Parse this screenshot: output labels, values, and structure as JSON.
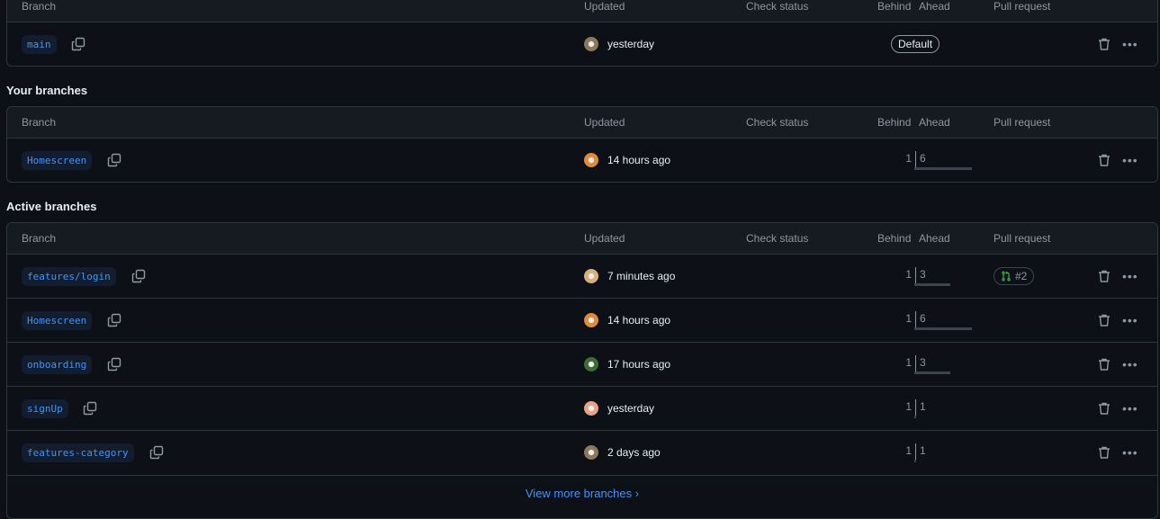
{
  "columns": {
    "branch": "Branch",
    "updated": "Updated",
    "check": "Check status",
    "behind": "Behind",
    "ahead": "Ahead",
    "pr": "Pull request"
  },
  "default_section": {
    "rows": [
      {
        "name": "main",
        "updated": "yesterday",
        "avatar": "#8a7a5a",
        "badge": "Default"
      }
    ]
  },
  "your_branches": {
    "title": "Your branches",
    "rows": [
      {
        "name": "Homescreen",
        "updated": "14 hours ago",
        "avatar": "#e08a3a",
        "behind": 1,
        "ahead": 6
      }
    ]
  },
  "active_branches": {
    "title": "Active branches",
    "rows": [
      {
        "name": "features/login",
        "updated": "7 minutes ago",
        "avatar": "#d9b07a",
        "behind": 1,
        "ahead": 3,
        "pr": "#2"
      },
      {
        "name": "Homescreen",
        "updated": "14 hours ago",
        "avatar": "#e08a3a",
        "behind": 1,
        "ahead": 6
      },
      {
        "name": "onboarding",
        "updated": "17 hours ago",
        "avatar": "#3f6b35",
        "behind": 1,
        "ahead": 3
      },
      {
        "name": "signUp",
        "updated": "yesterday",
        "avatar": "#e7a585",
        "behind": 1,
        "ahead": 1
      },
      {
        "name": "features-category",
        "updated": "2 days ago",
        "avatar": "#8a7a5a",
        "behind": 1,
        "ahead": 1
      }
    ],
    "view_more": "View more branches"
  },
  "colors": {
    "bg": "#0d1117",
    "header": "#161b22",
    "link": "#4493f8",
    "pr_open": "#3fb950"
  }
}
